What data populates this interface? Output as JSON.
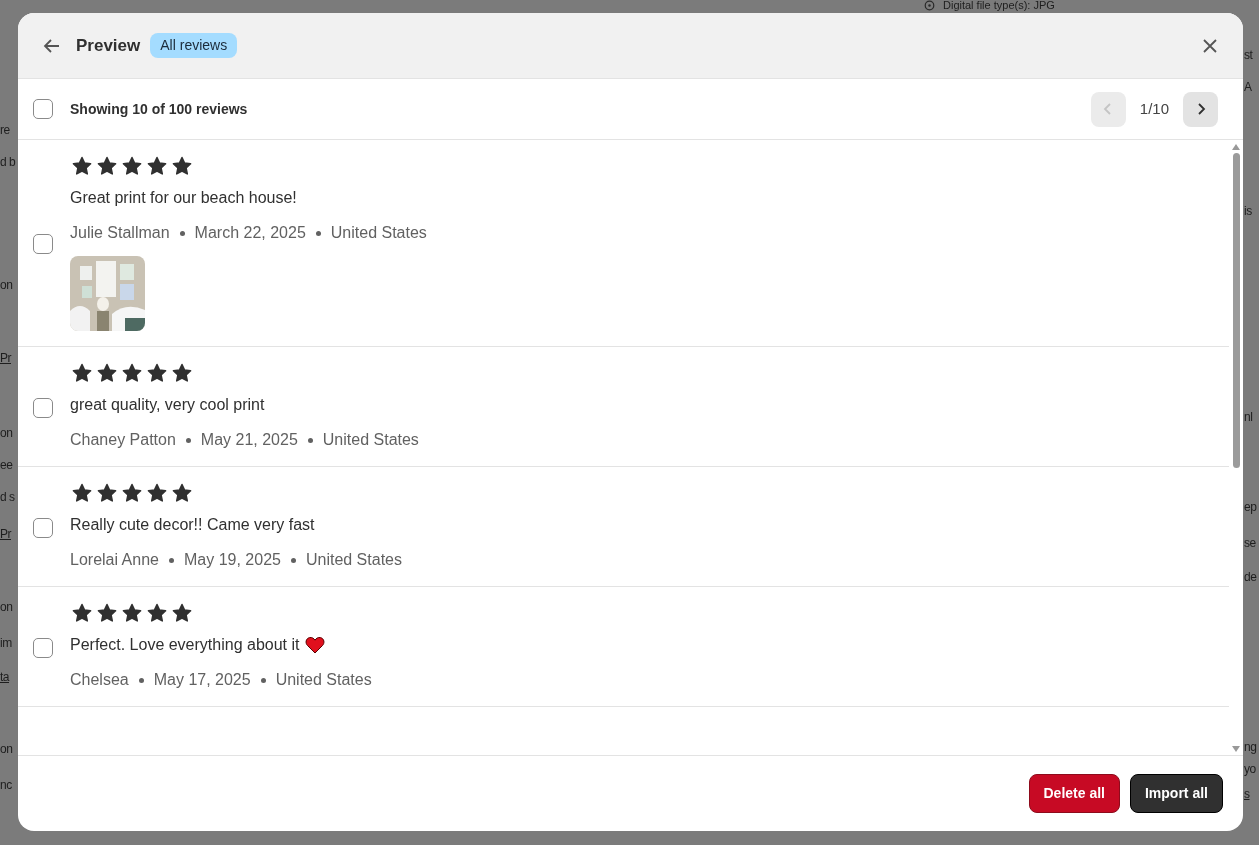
{
  "backdrop": {
    "top_text": "Digital file type(s): JPG",
    "left_fragments": [
      "re",
      "d b",
      "on",
      "Pr",
      "on",
      "ee",
      "d s",
      "Pr",
      "on",
      "im",
      "ta",
      "on",
      "nc"
    ],
    "right_fragments": [
      "st",
      "A",
      "is",
      "nl",
      "ep",
      "se",
      "de",
      "ng",
      "yo",
      "s"
    ]
  },
  "modal": {
    "title": "Preview",
    "badge": "All reviews",
    "toolbar": {
      "select_all": {
        "checked": false
      },
      "summary": "Showing 10 of 100 reviews",
      "pager": {
        "prev_disabled": true,
        "page": "1/10",
        "next_disabled": false
      }
    },
    "reviews": [
      {
        "checked": false,
        "stars": 5,
        "text": "Great print for our beach house!",
        "heart": false,
        "author": "Julie Stallman",
        "date": "March 22, 2025",
        "country": "United States"
      },
      {
        "checked": false,
        "stars": 5,
        "text": "great quality, very cool print",
        "heart": false,
        "author": "Chaney Patton",
        "date": "May 21, 2025",
        "country": "United States"
      },
      {
        "checked": false,
        "stars": 5,
        "text": "Really cute decor!! Came very fast",
        "heart": false,
        "author": "Lorelai Anne",
        "date": "May 19, 2025",
        "country": "United States"
      },
      {
        "checked": false,
        "stars": 5,
        "text": "Perfect. Love everything about it",
        "heart": true,
        "author": "Chelsea",
        "date": "May 17, 2025",
        "country": "United States"
      }
    ],
    "buttons": [
      {
        "label": "Delete all",
        "kind": "danger"
      },
      {
        "label": "Import all",
        "kind": "primary"
      }
    ]
  }
}
